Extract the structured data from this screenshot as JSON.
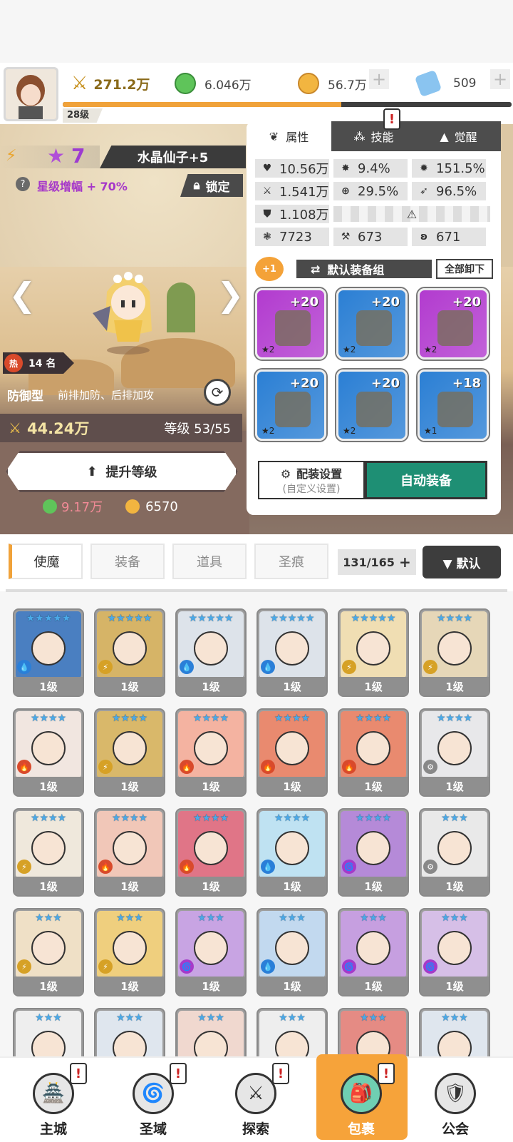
{
  "top": {
    "level": "28级",
    "power": "271.2万",
    "green": "6.046万",
    "gold": "56.7万",
    "gem": "509",
    "xp_progress": 0.62
  },
  "hero": {
    "star": "7",
    "name": "水晶仙子+5",
    "bonus": "星级增幅 + 70%",
    "lock": "锁定",
    "hot": "14 名",
    "hot_icon": "热",
    "type": "防御型",
    "type_desc": "前排加防、后排加攻",
    "power": "44.24万",
    "level": "等级 53/55",
    "upgrade": "提升等级",
    "cost_green": "9.17万",
    "cost_gold": "6570"
  },
  "panel": {
    "tabs": [
      "属性",
      "技能",
      "觉醒"
    ],
    "stats": [
      [
        {
          "icon": "♥",
          "v": "10.56万"
        },
        {
          "icon": "✸",
          "v": "9.4%"
        },
        {
          "icon": "✹",
          "v": "151.5%"
        }
      ],
      [
        {
          "icon": "⚔",
          "v": "1.541万"
        },
        {
          "icon": "⊕",
          "v": "29.5%"
        },
        {
          "icon": "➶",
          "v": "96.5%"
        }
      ],
      [
        {
          "icon": "⛊",
          "v": "1.108万"
        }
      ],
      [
        {
          "icon": "❃",
          "v": "7723"
        },
        {
          "icon": "⚒",
          "v": "673"
        },
        {
          "icon": "ʚ",
          "v": "671"
        }
      ]
    ],
    "plus_one": "+1",
    "set_name": "默认装备组",
    "unequip": "全部卸下",
    "slots": [
      {
        "lvl": "+20",
        "stars": "★2",
        "color": "#b23bcf"
      },
      {
        "lvl": "+20",
        "stars": "★2",
        "color": "#2b7fd4"
      },
      {
        "lvl": "+20",
        "stars": "★2",
        "color": "#b23bcf"
      },
      {
        "lvl": "+20",
        "stars": "★2",
        "color": "#2b7fd4"
      },
      {
        "lvl": "+20",
        "stars": "★2",
        "color": "#2b7fd4"
      },
      {
        "lvl": "+18",
        "stars": "★1",
        "color": "#2b7fd4"
      }
    ],
    "config": "配装设置",
    "config_sub": "(自定义设置)",
    "auto": "自动装备"
  },
  "bag": {
    "tabs": [
      "使魔",
      "装备",
      "道具",
      "圣痕"
    ],
    "count": "131/165",
    "sort": "▼ 默认"
  },
  "cards": [
    {
      "stars": "★★★★★",
      "c": "#4a7fc1",
      "el": "💧",
      "elc": "#2a7fd8",
      "lv": "1级"
    },
    {
      "stars": "★★★★★",
      "c": "#d6b467",
      "el": "⚡",
      "elc": "#d6a126",
      "lv": "1级"
    },
    {
      "stars": "★★★★★",
      "c": "#dde3ea",
      "el": "💧",
      "elc": "#2a7fd8",
      "lv": "1级"
    },
    {
      "stars": "★★★★★",
      "c": "#dde3ea",
      "el": "💧",
      "elc": "#2a7fd8",
      "lv": "1级"
    },
    {
      "stars": "★★★★★",
      "c": "#f0deb3",
      "el": "⚡",
      "elc": "#d6a126",
      "lv": "1级"
    },
    {
      "stars": "★★★★",
      "c": "#e6d7b8",
      "el": "⚡",
      "elc": "#d6a126",
      "lv": "1级"
    },
    {
      "stars": "★★★★",
      "c": "#f1e6e0",
      "el": "🔥",
      "elc": "#d94a2b",
      "lv": "1级"
    },
    {
      "stars": "★★★★",
      "c": "#d9b86a",
      "el": "⚡",
      "elc": "#d6a126",
      "lv": "1级"
    },
    {
      "stars": "★★★★",
      "c": "#f4b3a1",
      "el": "🔥",
      "elc": "#d94a2b",
      "lv": "1级"
    },
    {
      "stars": "★★★★",
      "c": "#e98a6f",
      "el": "🔥",
      "elc": "#d94a2b",
      "lv": "1级"
    },
    {
      "stars": "★★★★",
      "c": "#e98a6f",
      "el": "🔥",
      "elc": "#d94a2b",
      "lv": "1级"
    },
    {
      "stars": "★★★★",
      "c": "#e8e8ea",
      "el": "⚙",
      "elc": "#888",
      "lv": "1级"
    },
    {
      "stars": "★★★★",
      "c": "#efe8dc",
      "el": "⚡",
      "elc": "#d6a126",
      "lv": "1级"
    },
    {
      "stars": "★★★★",
      "c": "#f1c7b8",
      "el": "🔥",
      "elc": "#d94a2b",
      "lv": "1级"
    },
    {
      "stars": "★★★★",
      "c": "#e07587",
      "el": "🔥",
      "elc": "#d94a2b",
      "lv": "1级"
    },
    {
      "stars": "★★★★",
      "c": "#bfe2f2",
      "el": "💧",
      "elc": "#2a7fd8",
      "lv": "1级"
    },
    {
      "stars": "★★★★",
      "c": "#b58ad8",
      "el": "🌀",
      "elc": "#a63ac9",
      "lv": "1级"
    },
    {
      "stars": "★★★",
      "c": "#e9e9e9",
      "el": "⚙",
      "elc": "#888",
      "lv": "1级"
    },
    {
      "stars": "★★★",
      "c": "#efe0c6",
      "el": "⚡",
      "elc": "#d6a126",
      "lv": "1级"
    },
    {
      "stars": "★★★",
      "c": "#efcf7e",
      "el": "⚡",
      "elc": "#d6a126",
      "lv": "1级"
    },
    {
      "stars": "★★★",
      "c": "#c8a4e3",
      "el": "🌀",
      "elc": "#a63ac9",
      "lv": "1级"
    },
    {
      "stars": "★★★",
      "c": "#c2d9ef",
      "el": "💧",
      "elc": "#2a7fd8",
      "lv": "1级"
    },
    {
      "stars": "★★★",
      "c": "#c69fe0",
      "el": "🌀",
      "elc": "#a63ac9",
      "lv": "1级"
    },
    {
      "stars": "★★★",
      "c": "#d6bfe7",
      "el": "🌀",
      "elc": "#a63ac9",
      "lv": "1级"
    },
    {
      "stars": "★★★",
      "c": "#eee",
      "el": "",
      "elc": "#888",
      "lv": ""
    },
    {
      "stars": "★★★",
      "c": "#dfe6ee",
      "el": "",
      "elc": "#888",
      "lv": ""
    },
    {
      "stars": "★★★",
      "c": "#f0d8cf",
      "el": "",
      "elc": "#888",
      "lv": ""
    },
    {
      "stars": "★★★",
      "c": "#eee",
      "el": "",
      "elc": "#888",
      "lv": ""
    },
    {
      "stars": "★★★",
      "c": "#e58b84",
      "el": "",
      "elc": "#888",
      "lv": ""
    },
    {
      "stars": "★★★",
      "c": "#dfe6ee",
      "el": "",
      "elc": "#888",
      "lv": ""
    }
  ],
  "nav": [
    {
      "label": "主城",
      "icon": "🏯"
    },
    {
      "label": "圣域",
      "icon": "🌀"
    },
    {
      "label": "探索",
      "icon": "⚔"
    },
    {
      "label": "包裹",
      "icon": "🎒"
    },
    {
      "label": "公会",
      "icon": "🛡"
    }
  ],
  "badge": "!"
}
